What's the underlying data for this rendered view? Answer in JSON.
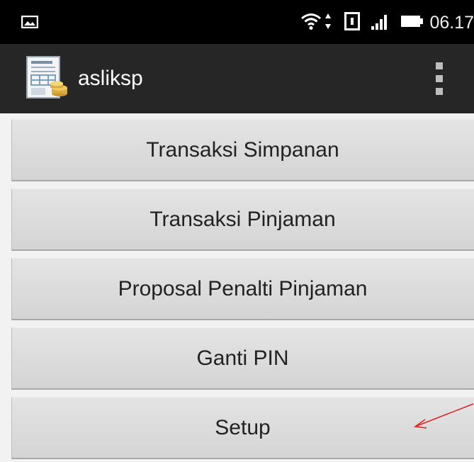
{
  "status_bar": {
    "time": "06.17",
    "icons": [
      "image-notification-icon",
      "wifi-icon",
      "data-transfer-icon",
      "sim-icon",
      "signal-icon",
      "battery-icon"
    ]
  },
  "action_bar": {
    "app_title": "asliksp",
    "app_icon": "app-logo-icon",
    "overflow_icon": "overflow-menu-icon"
  },
  "menu": {
    "items": [
      {
        "label": "Transaksi Simpanan"
      },
      {
        "label": "Transaksi Pinjaman"
      },
      {
        "label": "Proposal Penalti Pinjaman"
      },
      {
        "label": "Ganti PIN"
      },
      {
        "label": "Setup"
      }
    ]
  },
  "annotation": {
    "color": "#e02020"
  },
  "colors": {
    "status_bar_bg": "#000000",
    "action_bar_bg": "#262626",
    "button_bg": "#dcdcdc",
    "button_text": "#222222"
  }
}
